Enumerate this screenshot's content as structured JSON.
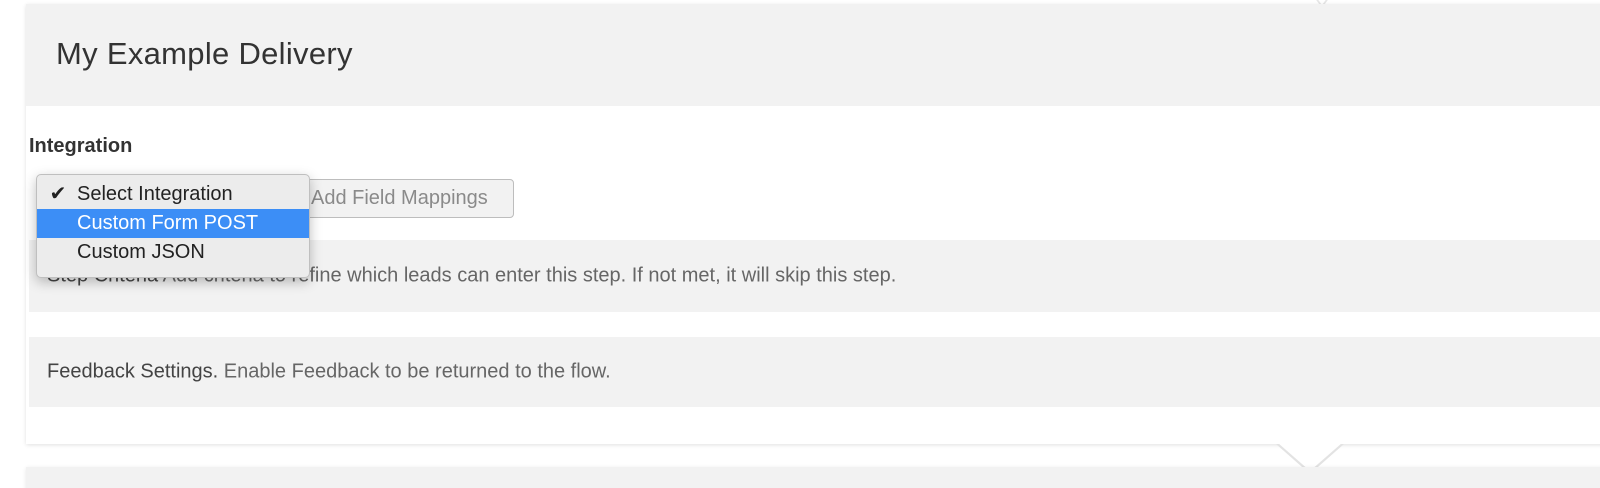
{
  "step": {
    "title": "My Example Delivery",
    "integration_label": "Integration",
    "add_field_mappings_label": "Add Field Mappings",
    "criteria": {
      "title": "Step Criteria",
      "description": "Add criteria to refine which leads can enter this step. If not met, it will skip this step."
    },
    "feedback": {
      "title": "Feedback Settings.",
      "description": "Enable Feedback to be returned to the flow."
    }
  },
  "integration_dropdown": {
    "selected": "Select Integration",
    "highlighted": "Custom Form POST",
    "options": [
      {
        "label": "Select Integration",
        "checked": true
      },
      {
        "label": "Custom Form POST",
        "checked": false
      },
      {
        "label": "Custom JSON",
        "checked": false
      }
    ]
  },
  "icons": {
    "checkmark": "checkmark-icon"
  },
  "colors": {
    "highlight": "#3c8ef6",
    "panel_background": "#f2f2f2"
  }
}
